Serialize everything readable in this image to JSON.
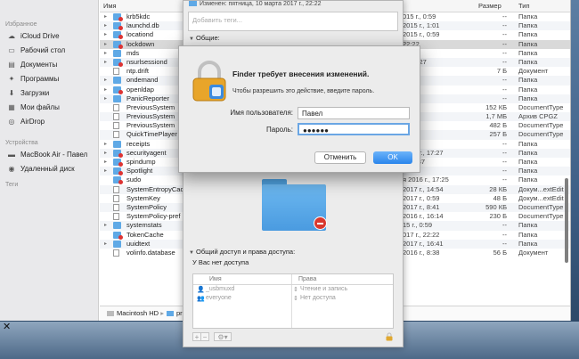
{
  "sidebar": {
    "sections": [
      {
        "title": "Избранное",
        "items": [
          {
            "label": "iCloud Drive",
            "icon": "cloud-icon"
          },
          {
            "label": "Рабочий стол",
            "icon": "desktop-icon"
          },
          {
            "label": "Документы",
            "icon": "documents-icon"
          },
          {
            "label": "Программы",
            "icon": "applications-icon"
          },
          {
            "label": "Загрузки",
            "icon": "downloads-icon"
          },
          {
            "label": "Мои файлы",
            "icon": "all-files-icon"
          },
          {
            "label": "AirDrop",
            "icon": "airdrop-icon"
          }
        ]
      },
      {
        "title": "Устройства",
        "items": [
          {
            "label": "MacBook Air - Павел",
            "icon": "laptop-icon"
          },
          {
            "label": "Удаленный диск",
            "icon": "disc-icon"
          }
        ]
      },
      {
        "title": "Теги",
        "items": []
      }
    ]
  },
  "list": {
    "columns": {
      "name": "Имя",
      "size": "Размер",
      "kind": "Тип"
    },
    "rows": [
      {
        "name": "krb5kdc",
        "date": "015 г., 0:59",
        "size": "--",
        "kind": "Папка",
        "icon": "lockf",
        "tri": "▸"
      },
      {
        "name": "launchd.db",
        "date": "2015 г., 1:01",
        "size": "--",
        "kind": "Папка",
        "icon": "lockf",
        "tri": "▸"
      },
      {
        "name": "locationd",
        "date": "2015 г., 0:59",
        "size": "--",
        "kind": "Папка",
        "icon": "lockf",
        "tri": "▸"
      },
      {
        "name": "lockdown",
        "date": "22:22",
        "size": "--",
        "kind": "Папка",
        "icon": "lockf",
        "tri": "▸",
        "selected": true
      },
      {
        "name": "mds",
        "date": "22:22",
        "size": "--",
        "kind": "Папка",
        "icon": "folder",
        "tri": "▸"
      },
      {
        "name": "nsurlsessiond",
        "date": "г., 17:27",
        "size": "--",
        "kind": "Папка",
        "icon": "lockf",
        "tri": "▸"
      },
      {
        "name": "ntp.drift",
        "date": "16:37",
        "size": "7 Б",
        "kind": "Документ",
        "icon": "doc",
        "tri": ""
      },
      {
        "name": "ondemand",
        "date": "",
        "size": "--",
        "kind": "Папка",
        "icon": "folder",
        "tri": "▸"
      },
      {
        "name": "openldap",
        "date": "23:32",
        "size": "--",
        "kind": "Папка",
        "icon": "lockf",
        "tri": "▸"
      },
      {
        "name": "PanicReporter",
        "date": "23:32",
        "size": "--",
        "kind": "Папка",
        "icon": "folder",
        "tri": "▸"
      },
      {
        "name": "PreviousSystem",
        "date": "1:12",
        "size": "152 КБ",
        "kind": "DocumentType",
        "icon": "doc",
        "tri": ""
      },
      {
        "name": "PreviousSystem",
        "date": "17:10",
        "size": "1,7 МБ",
        "kind": "Архив CPGZ",
        "icon": "doc",
        "tri": ""
      },
      {
        "name": "PreviousSystem",
        "date": "4:36",
        "size": "482 Б",
        "kind": "DocumentType",
        "icon": "doc",
        "tri": ""
      },
      {
        "name": "QuickTimePlayer",
        "date": "43",
        "size": "257 Б",
        "kind": "DocumentType",
        "icon": "doc",
        "tri": ""
      },
      {
        "name": "receipts",
        "date": "16:40",
        "size": "--",
        "kind": "Папка",
        "icon": "folder",
        "tri": "▸"
      },
      {
        "name": "securityagent",
        "date": "2016 г., 17:27",
        "size": "--",
        "kind": "Папка",
        "icon": "lockf",
        "tri": "▸"
      },
      {
        "name": "spindump",
        "date": "., 16:37",
        "size": "--",
        "kind": "Папка",
        "icon": "lockf",
        "tri": "▸"
      },
      {
        "name": "Spotlight",
        "date": "",
        "size": "--",
        "kind": "Папка",
        "icon": "lockf",
        "tri": "▸"
      },
      {
        "name": "sudo",
        "date": "я 2016 г., 17:25",
        "size": "--",
        "kind": "Папка",
        "icon": "lockf",
        "tri": ""
      },
      {
        "name": "SystemEntropyCac",
        "date": "2017 г., 14:54",
        "size": "28 КБ",
        "kind": "Докум...extEdit",
        "icon": "doc",
        "tri": ""
      },
      {
        "name": "SystemKey",
        "date": "2017 г., 0:59",
        "size": "48 Б",
        "kind": "Докум...extEdit",
        "icon": "doc",
        "tri": ""
      },
      {
        "name": "SystemPolicy",
        "date": "2017 г., 8:41",
        "size": "590 КБ",
        "kind": "DocumentType",
        "icon": "doc",
        "tri": ""
      },
      {
        "name": "SystemPolicy-pref",
        "date": "2016 г., 16:14",
        "size": "230 Б",
        "kind": "DocumentType",
        "icon": "doc",
        "tri": ""
      },
      {
        "name": "systemstats",
        "date": "15 г., 0:59",
        "size": "--",
        "kind": "Папка",
        "icon": "folder",
        "tri": "▸"
      },
      {
        "name": "TokenCache",
        "date": "017 г., 22:22",
        "size": "--",
        "kind": "Папка",
        "icon": "lockf",
        "tri": ""
      },
      {
        "name": "uuidtext",
        "date": "2017 г., 16:41",
        "size": "--",
        "kind": "Папка",
        "icon": "folder",
        "tri": "▸"
      },
      {
        "name": "volinfo.database",
        "date": "2016 г., 8:38",
        "size": "56 Б",
        "kind": "Документ",
        "icon": "doc",
        "tri": ""
      }
    ]
  },
  "pathbar": {
    "disk": "Macintosh HD",
    "next": "pr"
  },
  "info": {
    "modified": "Изменен: пятница, 10 марта 2017 г., 22:22",
    "tags_placeholder": "Добавить теги...",
    "general_title": "Общие:",
    "sharing_title": "Общий доступ и права доступа:",
    "no_access": "У Вас нет доступа",
    "perm_headers": {
      "name": "Имя",
      "rights": "Права"
    },
    "permissions": [
      {
        "name": "_usbmuxd",
        "rights": "Чтение и запись"
      },
      {
        "name": "everyone",
        "rights": "Нет доступа"
      }
    ],
    "toolbar": {
      "add": "+",
      "remove": "−",
      "gear": "⚙▾"
    }
  },
  "dialog": {
    "title": "Finder требует внесения изменений.",
    "message": "Чтобы разрешить это действие, введите пароль.",
    "username_label": "Имя пользователя:",
    "username_value": "Павел",
    "password_label": "Пароль:",
    "password_value": "●●●●●●",
    "cancel": "Отменить",
    "ok": "OK"
  },
  "colors": {
    "accent": "#2a85ec",
    "folder": "#5fa9e6",
    "no_entry": "#d9382e"
  }
}
